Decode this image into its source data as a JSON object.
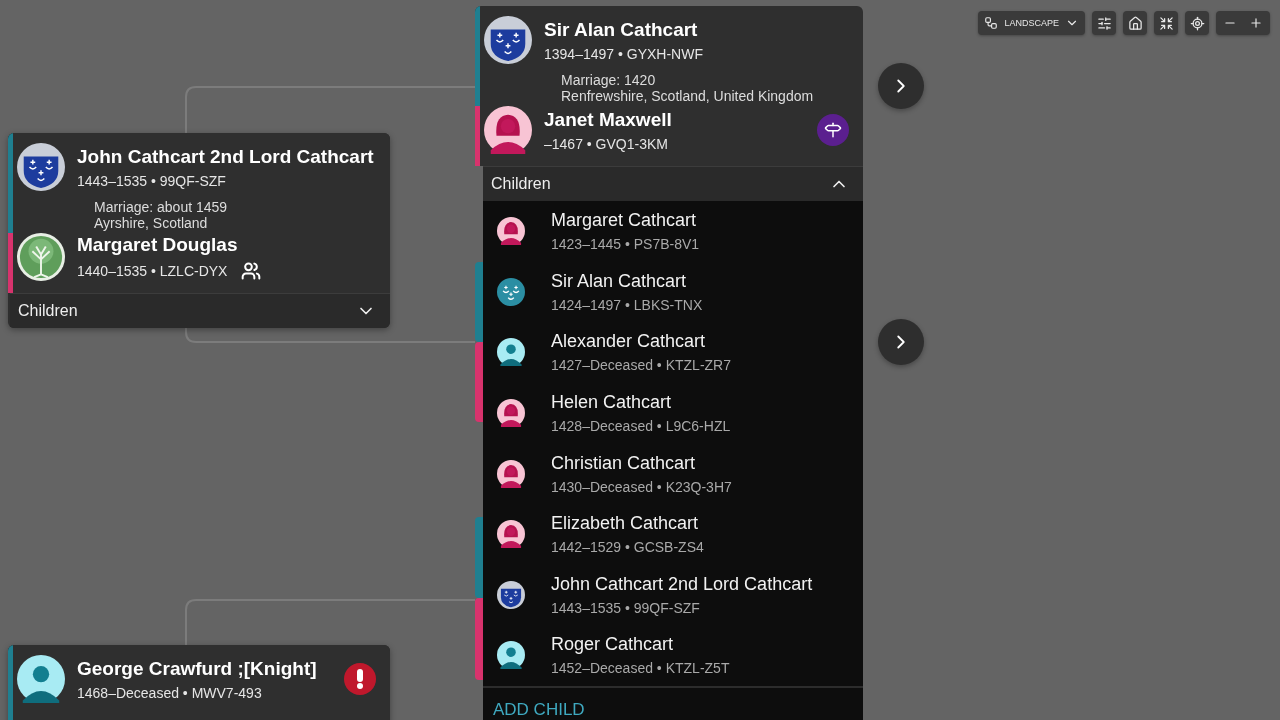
{
  "toolbar": {
    "layout": "LANDSCAPE"
  },
  "families": [
    {
      "husband": {
        "name": "John Cathcart 2nd Lord Cathcart",
        "detail": "1443–1535 • 99QF-SZF",
        "female": false,
        "kind": "crest"
      },
      "marriage": {
        "date": "Marriage: about 1459",
        "place": "Ayrshire, Scotland"
      },
      "wife": {
        "name": "Margaret Douglas",
        "detail": "1440–1535 • LZLC-DYX",
        "female": true,
        "kind": "tree",
        "badge": {
          "kind": "relatives"
        }
      },
      "children": {
        "label": "Children",
        "expanded": false
      }
    },
    {
      "husband": {
        "name": "Sir Alan Cathcart",
        "detail": "1394–1497 • GYXH-NWF",
        "female": false,
        "kind": "crest"
      },
      "marriage": {
        "date": "Marriage: 1420",
        "place": "Renfrewshire, Scotland, United Kingdom"
      },
      "wife": {
        "name": "Janet Maxwell",
        "detail": "–1467 • GVQ1-3KM",
        "female": true,
        "kind": "woman",
        "badge": {
          "kind": "signpost"
        }
      },
      "children": {
        "label": "Children",
        "expanded": true,
        "add_label": "ADD CHILD",
        "items": [
          {
            "name": "Margaret Cathcart",
            "detail": "1423–1445 • PS7B-8V1",
            "kind": "woman"
          },
          {
            "name": "Sir Alan Cathcart",
            "detail": "1424–1497 • LBKS-TNX",
            "kind": "crest-teal"
          },
          {
            "name": "Alexander Cathcart",
            "detail": "1427–Deceased • KTZL-ZR7",
            "kind": "man"
          },
          {
            "name": "Helen Cathcart",
            "detail": "1428–Deceased • L9C6-HZL",
            "kind": "woman"
          },
          {
            "name": "Christian Cathcart",
            "detail": "1430–Deceased • K23Q-3H7",
            "kind": "woman"
          },
          {
            "name": "Elizabeth Cathcart",
            "detail": "1442–1529 • GCSB-ZS4",
            "kind": "woman"
          },
          {
            "name": "John Cathcart 2nd Lord Cathcart",
            "detail": "1443–1535 • 99QF-SZF",
            "kind": "crest"
          },
          {
            "name": "Roger Cathcart",
            "detail": "1452–Deceased • KTZL-Z5T",
            "kind": "man"
          }
        ]
      }
    },
    {
      "husband": {
        "name": "George Crawfurd ;[Knight]",
        "detail": "1468–Deceased • MWV7-493",
        "female": false,
        "kind": "man",
        "badge": {
          "kind": "alert"
        }
      }
    }
  ]
}
